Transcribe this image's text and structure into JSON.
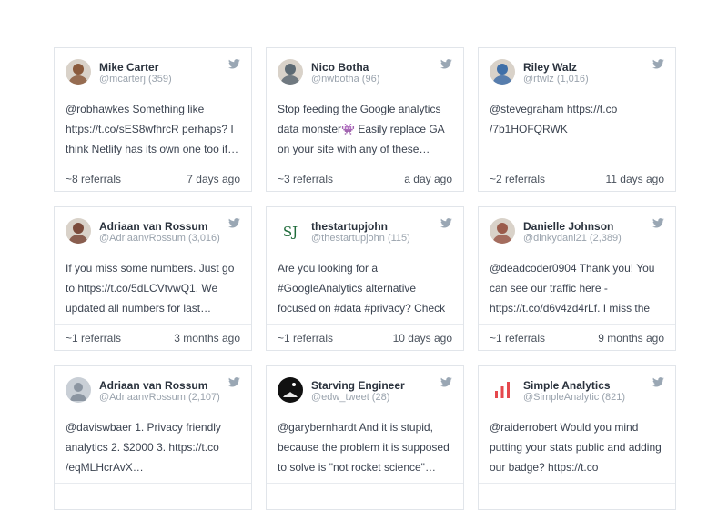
{
  "cards": [
    {
      "name": "Mike Carter",
      "handle": "@mcarterj (359)",
      "text": "@robhawkes Something like https://t.co/sES8wfhrcR perhaps? I think Netlify has its own one too if…",
      "referrals": "~8 referrals",
      "age": "7 days ago",
      "avatar_icon": "person-photo-avatar",
      "avatar_color": "#8a5a3c"
    },
    {
      "name": "Nico Botha",
      "handle": "@nwbotha (96)",
      "text": "Stop feeding the Google analytics data monster👾 Easily replace GA on your site with any of these privacy…",
      "referrals": "~3 referrals",
      "age": "a day ago",
      "avatar_icon": "person-photo-avatar",
      "avatar_color": "#5d6a73"
    },
    {
      "name": "Riley Walz",
      "handle": "@rtwlz (1,016)",
      "text": "@stevegraham https://t.co /7b1HOFQRWK",
      "referrals": "~2 referrals",
      "age": "11 days ago",
      "avatar_icon": "person-photo-avatar",
      "avatar_color": "#3f6fa8"
    },
    {
      "name": "Adriaan van Rossum",
      "handle": "@AdriaanvRossum (3,016)",
      "text": "If you miss some numbers. Just go to https://t.co/5dLCVtvwQ1. We updated all numbers for last month…",
      "referrals": "~1 referrals",
      "age": "3 months ago",
      "avatar_icon": "person-photo-avatar",
      "avatar_color": "#7a4a3a"
    },
    {
      "name": "thestartupjohn",
      "handle": "@thestartupjohn (115)",
      "text": "Are you looking for a #GoogleAnalytics alternative focused on #data #privacy? Check",
      "referrals": "~1 referrals",
      "age": "10 days ago",
      "avatar_icon": "sj-logo-avatar",
      "avatar_text": "SJ",
      "avatar_color": "#1f6b3a"
    },
    {
      "name": "Danielle Johnson",
      "handle": "@dinkydani21 (2,389)",
      "text": "@deadcoder0904 Thank you! You can see our traffic here - https://t.co/d6v4zd4rLf. I miss the",
      "referrals": "~1 referrals",
      "age": "9 months ago",
      "avatar_icon": "person-photo-avatar",
      "avatar_color": "#9a5b4b"
    },
    {
      "name": "Adriaan van Rossum",
      "handle": "@AdriaanvRossum (2,107)",
      "text": "@daviswbaer 1. Privacy friendly analytics 2. $2000 3. https://t.co /eqMLHcrAvX…",
      "referrals": "",
      "age": "",
      "avatar_icon": "default-user-avatar",
      "avatar_color": "#c9cfd6"
    },
    {
      "name": "Starving Engineer",
      "handle": "@edw_tweet (28)",
      "text": "@garybernhardt And it is stupid, because the problem it is supposed to solve is \"not rocket science\" and…",
      "referrals": "",
      "age": "",
      "avatar_icon": "dark-photo-avatar",
      "avatar_color": "#111111"
    },
    {
      "name": "Simple Analytics",
      "handle": "@SimpleAnalytic (821)",
      "text": "@raiderrobert Would you mind putting your stats public and adding our badge? https://t.co",
      "referrals": "",
      "age": "",
      "avatar_icon": "bar-chart-logo-avatar",
      "avatar_color": "#e5484d"
    }
  ],
  "colors": {
    "twitter_icon": "#9aa7b4",
    "border": "#e1e5ea"
  },
  "icons": {
    "twitter": "twitter-bird-icon"
  }
}
